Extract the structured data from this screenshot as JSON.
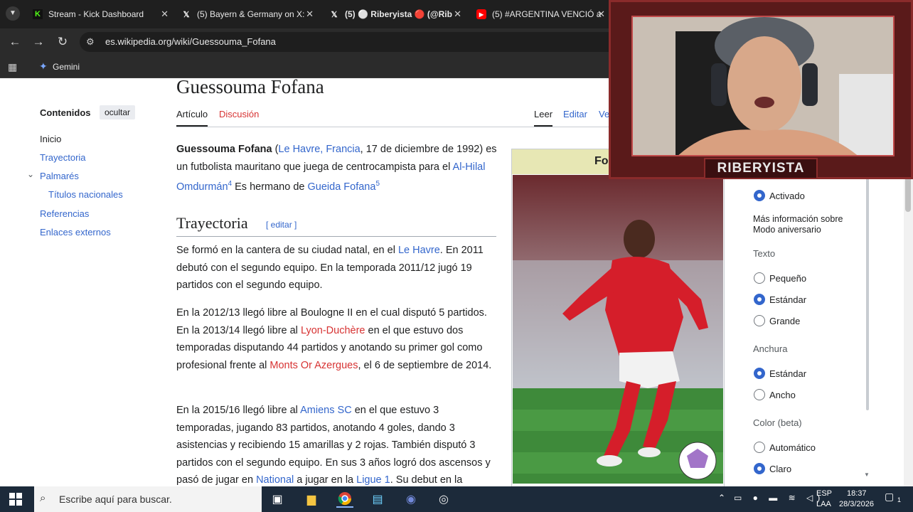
{
  "browser": {
    "tabs": [
      {
        "title": "Stream - Kick Dashboard",
        "icon": "kick-icon",
        "color": "#53fc18"
      },
      {
        "title": "(5) Bayern & Germany on X:",
        "icon": "x-icon",
        "color": "#ffffff"
      },
      {
        "title": "(5) ⚪ Riberyista 🔴 (@Rib",
        "icon": "x-icon",
        "color": "#ffffff"
      },
      {
        "title": "(5) #ARGENTINA VENCIÓ a",
        "icon": "youtube-icon",
        "color": "#ff0000"
      }
    ],
    "url": "es.wikipedia.org/wiki/Guessouma_Fofana",
    "bookmark": "Gemini"
  },
  "wiki": {
    "title": "Guessouma Fofana",
    "toc": {
      "heading": "Contenidos",
      "hide": "ocultar",
      "items": [
        "Inicio",
        "Trayectoria",
        "Palmarés",
        "Títulos nacionales",
        "Referencias",
        "Enlaces externos"
      ]
    },
    "tabs": {
      "article": "Artículo",
      "talk": "Discusión",
      "read": "Leer",
      "edit": "Editar",
      "history": "Ve"
    },
    "intro": {
      "name": "Guessouma Fofana",
      "p1": " (",
      "birthplace": "Le Havre, Francia",
      "p2": ", 17 de diciembre de 1992) es un futbolista mauritano que juega de centrocampista para el ",
      "club": "Al-Hilal Omdurmán",
      "ref1": "4",
      "p3": " Es hermano de ",
      "brother": "Gueida Fofana",
      "ref2": "5"
    },
    "section": {
      "title": "Trayectoria",
      "edit": "[ editar ]"
    },
    "para1": {
      "a": "Se formó en la cantera de su ciudad natal, en el ",
      "link": "Le Havre",
      "b": ". En 2011 debutó con el segundo equipo. En la temporada 2011/12 jugó 19 partidos con el segundo equipo."
    },
    "para2": {
      "a": "En la 2012/13 llegó libre al Boulogne II en el cual disputó 5 partidos. En la 2013/14 llegó libre al ",
      "link1": "Lyon-Duchère",
      "b": " en el que estuvo dos temporadas disputando 44 partidos y anotando su primer gol como profesional frente al ",
      "link2": "Monts Or Azergues",
      "c": ", el 6 de septiembre de 2014."
    },
    "para3": {
      "a": "En la 2015/16 llegó libre al ",
      "link1": "Amiens SC",
      "b": " en el que estuvo 3 temporadas, jugando 83 partidos, anotando 4 goles, dando 3 asistencias y recibiendo 15 amarillas y 2 rojas. También disputó 3 partidos con el segundo equipo. En sus 3 años logró dos ascensos y pasó de jugar en ",
      "link2": "National",
      "c": " a jugar en la ",
      "link3": "Ligue 1",
      "d": ". Su debut en la"
    },
    "infobox_title": "Fo",
    "appearance": {
      "anniversary_on": "Activado",
      "more_info": "Más información sobre Modo aniversario",
      "text_heading": "Texto",
      "text_options": [
        "Pequeño",
        "Estándar",
        "Grande"
      ],
      "text_selected": 1,
      "width_heading": "Anchura",
      "width_options": [
        "Estándar",
        "Ancho"
      ],
      "width_selected": 0,
      "color_heading": "Color (beta)",
      "color_options": [
        "Automático",
        "Claro"
      ],
      "color_selected": 1
    }
  },
  "webcam": {
    "label": "RIBERYISTA"
  },
  "taskbar": {
    "search_placeholder": "Escribe aquí para buscar.",
    "lang": "ESP",
    "region": "LAA",
    "time": "18:37",
    "date": "28/3/2026",
    "notifications": "1"
  }
}
